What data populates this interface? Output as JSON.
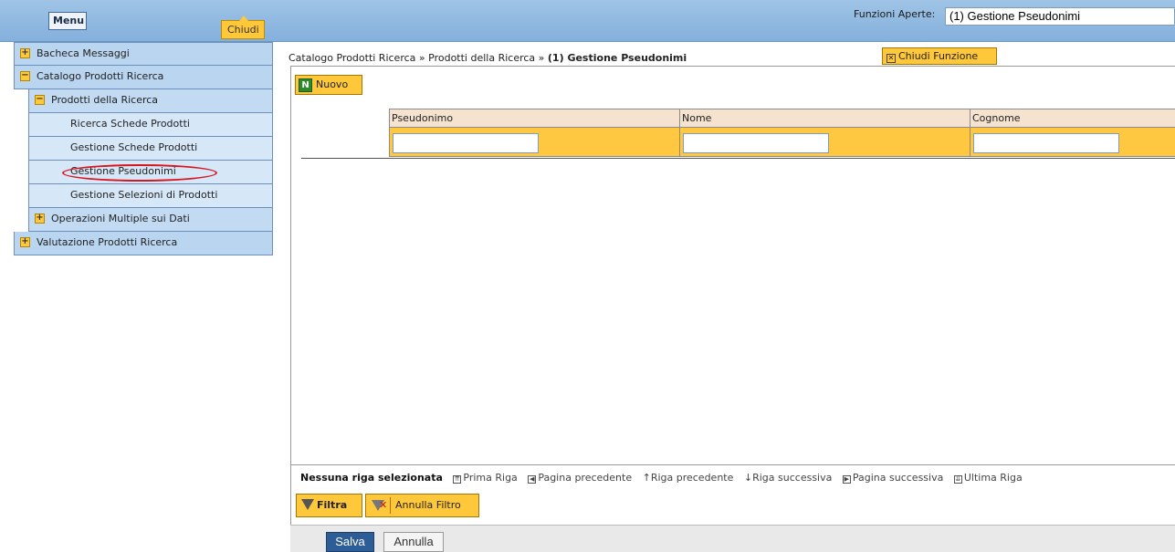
{
  "header": {
    "menu_label": "Menu",
    "close_menu_label": "Chiudi",
    "open_functions_label": "Funzioni Aperte:",
    "open_functions_value": "(1) Gestione Pseudonimi"
  },
  "menu": {
    "items": [
      {
        "label": "Bacheca Messaggi",
        "toggle": "+"
      },
      {
        "label": "Catalogo Prodotti Ricerca",
        "toggle": "−"
      },
      {
        "label": "Prodotti della Ricerca",
        "toggle": "−"
      },
      {
        "label": "Ricerca Schede Prodotti"
      },
      {
        "label": "Gestione Schede Prodotti"
      },
      {
        "label": "Gestione Pseudonimi"
      },
      {
        "label": "Gestione Selezioni di Prodotti"
      },
      {
        "label": "Operazioni Multiple sui Dati",
        "toggle": "+"
      },
      {
        "label": "Valutazione Prodotti Ricerca",
        "toggle": "+"
      }
    ]
  },
  "breadcrumb": {
    "part1": "Catalogo Prodotti Ricerca",
    "sep": "»",
    "part2": "Prodotti della Ricerca",
    "current": "(1) Gestione Pseudonimi"
  },
  "actions": {
    "close_function": "Chiudi Funzione",
    "new": "Nuovo",
    "new_icon": "N"
  },
  "grid": {
    "columns": [
      "Pseudonimo",
      "Nome",
      "Cognome"
    ]
  },
  "navigation": {
    "status": "Nessuna riga selezionata",
    "first": "Prima Riga",
    "prev_page": "Pagina precedente",
    "prev_row": "Riga precedente",
    "next_row": "Riga successiva",
    "next_page": "Pagina successiva",
    "last": "Ultima Riga"
  },
  "filters": {
    "apply": "Filtra",
    "cancel": "Annulla Filtro"
  },
  "footer": {
    "save": "Salva",
    "cancel": "Annulla"
  },
  "colors": {
    "accent": "#ffc83b",
    "topbar": "#9fc4e6",
    "save_button": "#2d5d96",
    "highlight_circle": "#d8161f"
  }
}
